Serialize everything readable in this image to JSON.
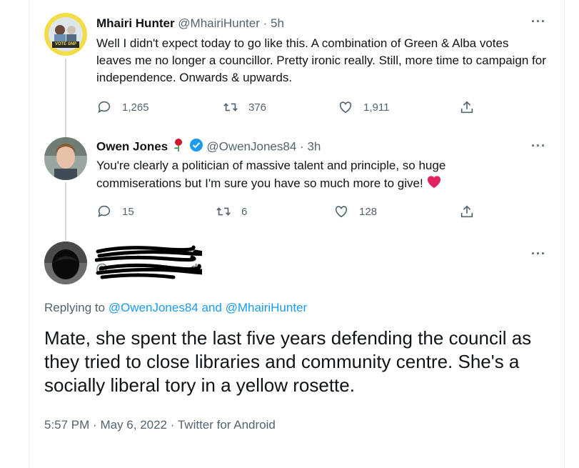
{
  "tweet1": {
    "name": "Mhairi Hunter",
    "handle": "@MhairiHunter",
    "time": "5h",
    "text": "Well I didn't expect today to go like this. A combination of Green & Alba votes leaves me no longer a councillor.  Pretty ironic really. Still, more time to campaign for independence. Onwards & upwards.",
    "replies": "1,265",
    "retweets": "376",
    "likes": "1,911",
    "avatar_text": "VOTE SNP"
  },
  "tweet2": {
    "name": "Owen Jones",
    "handle": "@OwenJones84",
    "time": "3h",
    "text": "You're clearly a politician of massive talent and principle, so huge commiserations but I'm sure you have so much more to give!",
    "replies": "15",
    "retweets": "6",
    "likes": "128"
  },
  "main_tweet": {
    "handle_partial": "@",
    "handle_suffix": "d",
    "replying_prefix": "Replying to",
    "replying_to_1": "@OwenJones84",
    "replying_and": "and",
    "replying_to_2": "@MhairiHunter",
    "text": "Mate, she spent the last five years defending the council as they tried to close libraries and community centre. She's a socially liberal tory in a yellow rosette.",
    "time": "5:57 PM",
    "date": "May 6, 2022",
    "source": "Twitter for Android",
    "separator": "·"
  },
  "colors": {
    "text": "#0f1419",
    "muted": "#536471",
    "link": "#1d9bf0",
    "verified": "#1d9bf0",
    "heart": "#e0245e"
  },
  "icons": [
    "reply-icon",
    "retweet-icon",
    "like-icon",
    "share-icon",
    "more-icon",
    "verified-icon",
    "rose-icon",
    "heart-emoji-icon"
  ]
}
